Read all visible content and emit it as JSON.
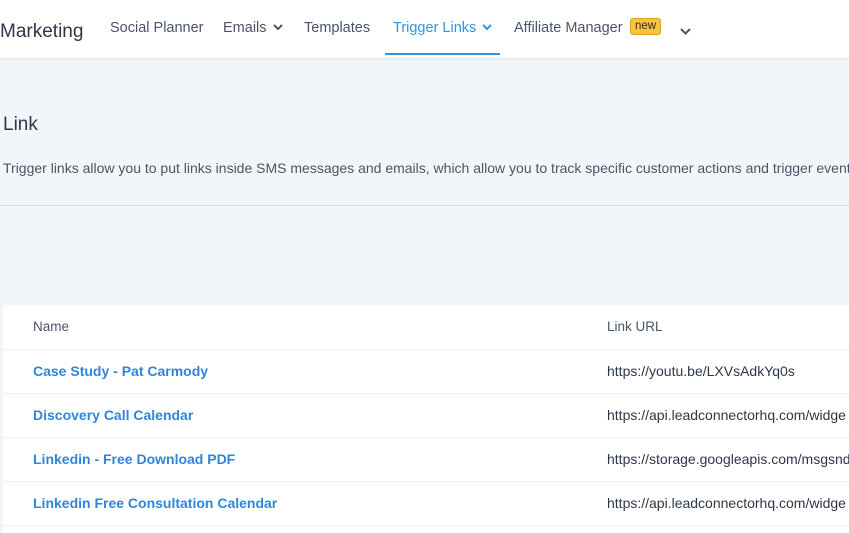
{
  "app": {
    "title": "Marketing"
  },
  "nav": {
    "items": [
      {
        "label": "Social Planner"
      },
      {
        "label": "Emails"
      },
      {
        "label": "Templates"
      },
      {
        "label": "Trigger Links"
      },
      {
        "label": "Affiliate Manager",
        "badge": "new"
      }
    ],
    "active": "Trigger Links",
    "accent_color": "#2f95e0",
    "badge_color": "#f6c344"
  },
  "page": {
    "title": "Link",
    "description": "Trigger links allow you to put links inside SMS messages and emails, which allow you to track specific customer actions and trigger events"
  },
  "table": {
    "columns": [
      "Name",
      "Link URL"
    ],
    "rows": [
      {
        "name": "Case Study - Pat Carmody",
        "url": "https://youtu.be/LXVsAdkYq0s"
      },
      {
        "name": "Discovery Call Calendar",
        "url": "https://api.leadconnectorhq.com/widge"
      },
      {
        "name": "Linkedin - Free Download PDF",
        "url": "https://storage.googleapis.com/msgsnd"
      },
      {
        "name": "Linkedin Free Consultation Calendar",
        "url": "https://api.leadconnectorhq.com/widge"
      }
    ]
  }
}
